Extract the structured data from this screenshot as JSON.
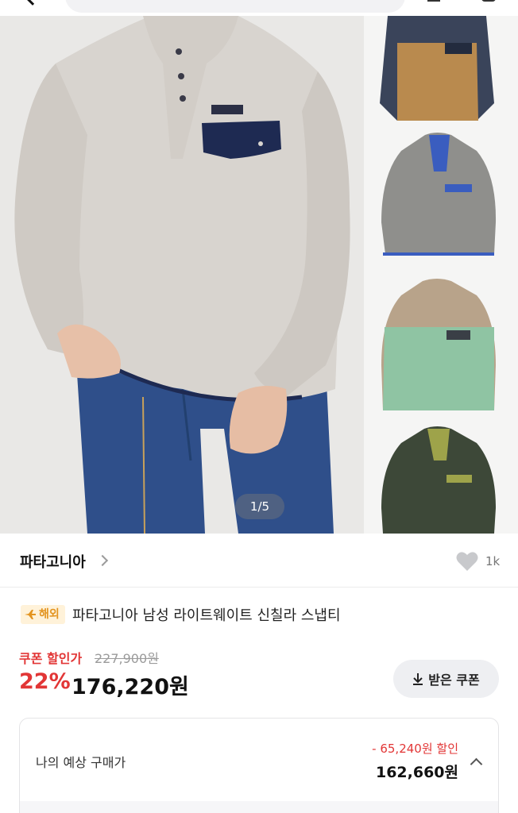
{
  "brand": {
    "name": "파타고니아",
    "like_count": "1k"
  },
  "product": {
    "badge": "해외",
    "title": "파타고니아 남성 라이트웨이트 신칠라 스냅티"
  },
  "gallery": {
    "indicator": "1/5"
  },
  "price": {
    "coupon_label": "쿠폰 할인가",
    "original": "227,900원",
    "discount_rate": "22%",
    "sale": "176,220원",
    "coupon_button": "받은 쿠폰"
  },
  "expected": {
    "label": "나의 예상 구매가",
    "discount": "- 65,240원 할인",
    "price": "162,660원"
  },
  "colors": {
    "accent_red": "#e23636",
    "badge_bg": "#fff2d9",
    "badge_text": "#e39420",
    "fleece_oatmeal": "#d8d4cf",
    "fleece_khaki": "#b98a4e",
    "fleece_gray": "#8f8f8c",
    "fleece_mint": "#8fc4a3",
    "fleece_forest": "#3d4838"
  }
}
